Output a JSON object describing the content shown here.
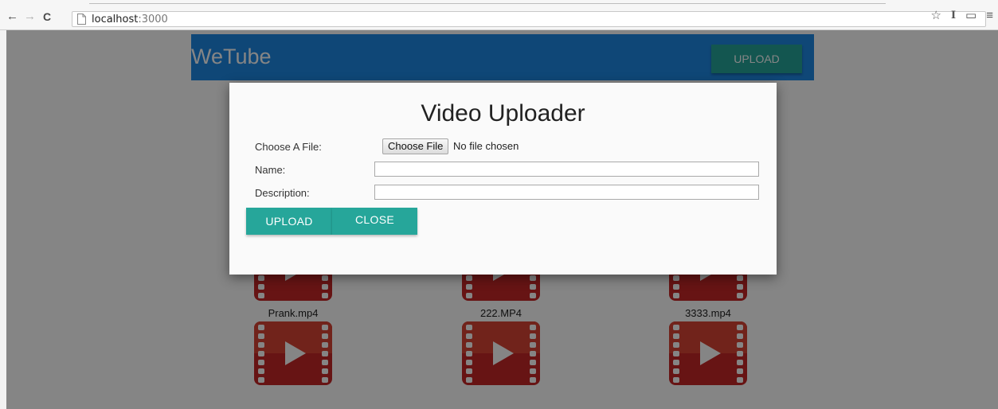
{
  "browser": {
    "back_glyph": "←",
    "forward_glyph": "→",
    "reload_glyph": "C",
    "url_host": "localhost",
    "url_port": ":3000",
    "star_glyph": "☆",
    "ext_glyph": "I",
    "cast_glyph": "▭",
    "menu_glyph": "≡"
  },
  "app": {
    "brand": "WeTube",
    "upload_label": "UPLOAD"
  },
  "videos": [
    {
      "label": "Prank.mp4"
    },
    {
      "label": "222.MP4"
    },
    {
      "label": "3333.mp4"
    },
    {
      "label": ""
    },
    {
      "label": ""
    },
    {
      "label": ""
    }
  ],
  "modal": {
    "title": "Video Uploader",
    "file_label": "Choose A File:",
    "file_button": "Choose File",
    "file_status": "No file chosen",
    "name_label": "Name:",
    "name_value": "",
    "description_label": "Description:",
    "description_value": "",
    "upload_button": "UPLOAD",
    "close_button": "CLOSE"
  },
  "colors": {
    "navbar": "#1e88e5",
    "accent": "#26a69a",
    "video_red": "#c62828"
  }
}
